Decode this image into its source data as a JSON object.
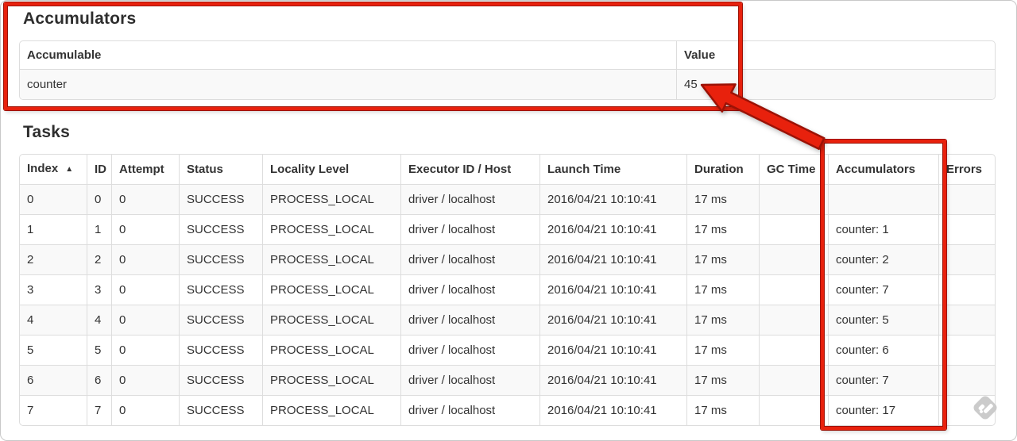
{
  "colors": {
    "annotation_red": "#e8210d",
    "annotation_red_dark": "#9c1206",
    "table_border": "#dddddd",
    "row_stripe": "#f9f9f9",
    "text": "#333333",
    "watermark_gray": "#c9c9c9"
  },
  "accumulators_section": {
    "title": "Accumulators",
    "table": {
      "headers": [
        "Accumulable",
        "Value"
      ],
      "rows": [
        [
          "counter",
          "45"
        ]
      ]
    }
  },
  "tasks_section": {
    "title": "Tasks",
    "table": {
      "headers": [
        "Index",
        "ID",
        "Attempt",
        "Status",
        "Locality Level",
        "Executor ID / Host",
        "Launch Time",
        "Duration",
        "GC Time",
        "Accumulators",
        "Errors"
      ],
      "sort_icon": "▲",
      "sorted_column": "Index",
      "rows": [
        [
          "0",
          "0",
          "0",
          "SUCCESS",
          "PROCESS_LOCAL",
          "driver / localhost",
          "2016/04/21 10:10:41",
          "17 ms",
          "",
          "",
          ""
        ],
        [
          "1",
          "1",
          "0",
          "SUCCESS",
          "PROCESS_LOCAL",
          "driver / localhost",
          "2016/04/21 10:10:41",
          "17 ms",
          "",
          "counter: 1",
          ""
        ],
        [
          "2",
          "2",
          "0",
          "SUCCESS",
          "PROCESS_LOCAL",
          "driver / localhost",
          "2016/04/21 10:10:41",
          "17 ms",
          "",
          "counter: 2",
          ""
        ],
        [
          "3",
          "3",
          "0",
          "SUCCESS",
          "PROCESS_LOCAL",
          "driver / localhost",
          "2016/04/21 10:10:41",
          "17 ms",
          "",
          "counter: 7",
          ""
        ],
        [
          "4",
          "4",
          "0",
          "SUCCESS",
          "PROCESS_LOCAL",
          "driver / localhost",
          "2016/04/21 10:10:41",
          "17 ms",
          "",
          "counter: 5",
          ""
        ],
        [
          "5",
          "5",
          "0",
          "SUCCESS",
          "PROCESS_LOCAL",
          "driver / localhost",
          "2016/04/21 10:10:41",
          "17 ms",
          "",
          "counter: 6",
          ""
        ],
        [
          "6",
          "6",
          "0",
          "SUCCESS",
          "PROCESS_LOCAL",
          "driver / localhost",
          "2016/04/21 10:10:41",
          "17 ms",
          "",
          "counter: 7",
          ""
        ],
        [
          "7",
          "7",
          "0",
          "SUCCESS",
          "PROCESS_LOCAL",
          "driver / localhost",
          "2016/04/21 10:10:41",
          "17 ms",
          "",
          "counter: 17",
          ""
        ]
      ]
    }
  },
  "annotations": {
    "accumulators_box": "highlight around Accumulators summary table",
    "tasks_column_box": "highlight around Accumulators column of Tasks table",
    "arrow": "arrow from Tasks Accumulators column to total value 45"
  }
}
